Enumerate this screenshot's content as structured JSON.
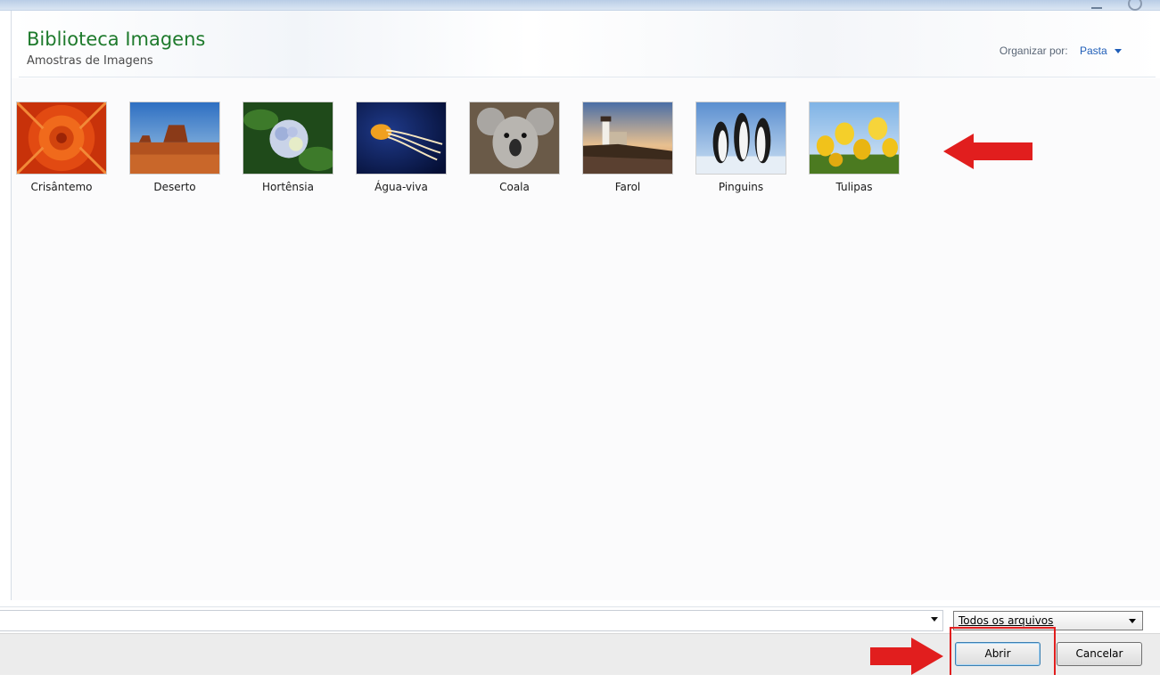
{
  "header": {
    "title": "Biblioteca Imagens",
    "subtitle": "Amostras de Imagens",
    "organize_label": "Organizar por:",
    "organize_value": "Pasta"
  },
  "images": [
    {
      "label": "Crisântemo"
    },
    {
      "label": "Deserto"
    },
    {
      "label": "Hortênsia"
    },
    {
      "label": "Água-viva"
    },
    {
      "label": "Coala"
    },
    {
      "label": "Farol"
    },
    {
      "label": "Pinguins"
    },
    {
      "label": "Tulipas"
    }
  ],
  "file_row": {
    "file_name_value": "",
    "file_type": "Todos os arquivos"
  },
  "buttons": {
    "open": "Abrir",
    "cancel": "Cancelar"
  },
  "colors": {
    "title_green": "#1e7a2c",
    "link_blue": "#1f5eb8",
    "annotation_red": "#e11e1e"
  }
}
